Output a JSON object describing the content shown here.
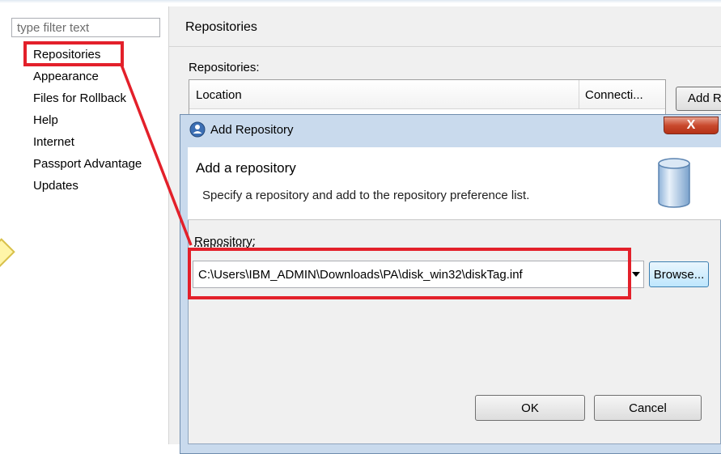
{
  "sidebar": {
    "filter_placeholder": "type filter text",
    "items": [
      {
        "label": "Repositories",
        "selected": true
      },
      {
        "label": "Appearance"
      },
      {
        "label": "Files for Rollback"
      },
      {
        "label": "Help"
      },
      {
        "label": "Internet"
      },
      {
        "label": "Passport Advantage"
      },
      {
        "label": "Updates"
      }
    ]
  },
  "page": {
    "title": "Repositories",
    "section_label": "Repositories:",
    "table": {
      "columns": [
        "Location",
        "Connecti..."
      ]
    },
    "add_button_label": "Add R"
  },
  "dialog": {
    "title": "Add Repository",
    "close_label": "X",
    "banner_title": "Add a repository",
    "banner_description": "Specify a repository and add to the repository preference list.",
    "repository_label": "Repository:",
    "repository_value": "C:\\Users\\IBM_ADMIN\\Downloads\\PA\\disk_win32\\diskTag.inf",
    "browse_label": "Browse...",
    "ok_label": "OK",
    "cancel_label": "Cancel"
  },
  "colors": {
    "highlight": "#e3202a",
    "dialog_frame": "#c9daed",
    "window_bg": "#f0f0f0"
  },
  "icons": {
    "dialog_icon": "installation-manager-icon",
    "banner_icon": "database-cylinder-icon",
    "dropdown_icon": "chevron-down-icon"
  }
}
